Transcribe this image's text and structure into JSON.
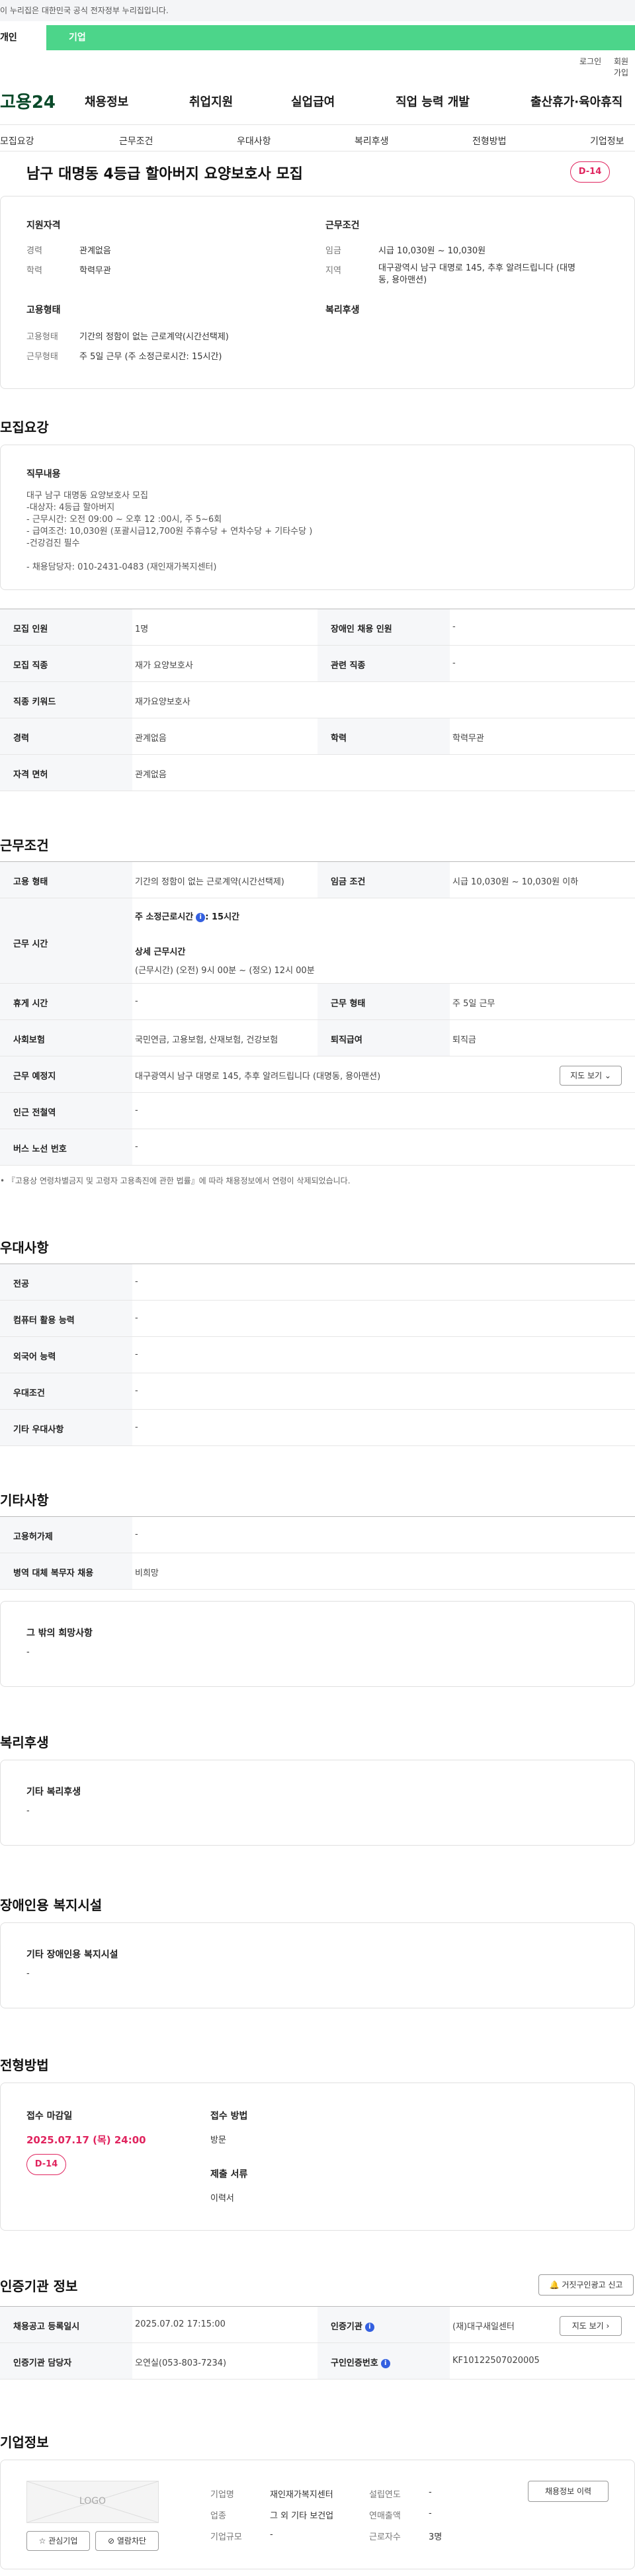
{
  "topbar": {
    "notice": "이 누리집은 대한민국 공식 전자정부 누리집입니다."
  },
  "tabs": {
    "personal": "개인",
    "corp": "기업"
  },
  "util": {
    "login": "로그인",
    "signup": "회원가입"
  },
  "logo": "고용24",
  "gnb": [
    "채용정보",
    "취업지원",
    "실업급여",
    "직업 능력 개발",
    "출산휴가·육아휴직"
  ],
  "subnav": [
    "모집요강",
    "근무조건",
    "우대사항",
    "복리후생",
    "전형방법",
    "기업정보"
  ],
  "job": {
    "title": "남구 대명동 4등급 할아버지 요양보호사 모집",
    "dday": "D-14"
  },
  "summary": {
    "qual_h": "지원자격",
    "cond_h": "근무조건",
    "career_k": "경력",
    "career_v": "관계없음",
    "edu_k": "학력",
    "edu_v": "학력무관",
    "wage_k": "임금",
    "wage_v": "시급 10,030원 ~ 10,030원",
    "region_k": "지역",
    "region_v1": "대구광역시 남구 대명로 145, 추후 알려드립니다 (대명",
    "region_v2": "동, 용아맨션)",
    "emp_h": "고용형태",
    "welfare_h": "복리후생",
    "emptype_k": "고용형태",
    "emptype_v": "기간의 정함이 없는 근로계약(시간선택제)",
    "worktype_k": "근무형태",
    "worktype_v": "주 5일 근무 (주 소정근로시간: 15시간)"
  },
  "recruit": {
    "section": "모집요강",
    "duty_h": "직무내용",
    "duty_lines": [
      "대구 남구 대명동  요양보호사 모집",
      "-대상자: 4등급 할아버지",
      "- 근무시간: 오전 09:00 ~ 오후 12 :00시, 주 5~6회",
      "- 급여조건: 10,030원 (포괄시급12,700원 주휴수당 + 연차수당 + 기타수당 )",
      "-건강검진 필수",
      "",
      "- 채용담당자: 010-2431-0483 (재인재가복지센터)"
    ],
    "rows": [
      {
        "k1": "모집 인원",
        "v1": "1명",
        "k2": "장애인 채용 인원",
        "v2": "-"
      },
      {
        "k1": "모집 직종",
        "v1": "재가 요양보호사",
        "k2": "관련 직종",
        "v2": "-"
      },
      {
        "k1": "직종 키워드",
        "v1": "재가요양보호사",
        "k2": "",
        "v2": ""
      },
      {
        "k1": "경력",
        "v1": "관계없음",
        "k2": "학력",
        "v2": "학력무관"
      },
      {
        "k1": "자격 면허",
        "v1": "관계없음",
        "k2": "",
        "v2": ""
      }
    ]
  },
  "conditions": {
    "section": "근무조건",
    "emp_k": "고용 형태",
    "emp_v": "기간의 정함이 없는 근로계약(시간선택제)",
    "wage_k": "임금 조건",
    "wage_v": "시급 10,030원 ~ 10,030원 이하",
    "hours_k": "근무 시간",
    "hours_main": "주 소정근로시간",
    "hours_val": ": 15시간",
    "detail_h": "상세 근무시간",
    "detail_v": "(근무시간) (오전) 9시 00분 ~ (정오) 12시 00분",
    "rest_k": "휴게 시간",
    "rest_v": "-",
    "worktype_k": "근무 형태",
    "worktype_v": "주 5일 근무",
    "ins_k": "사회보험",
    "ins_v": "국민연금, 고용보험, 산재보험, 건강보험",
    "ret_k": "퇴직급여",
    "ret_v": "퇴직금",
    "place_k": "근무 예정지",
    "place_v": "대구광역시 남구 대명로 145, 추후 알려드립니다 (대명동, 용아맨션)",
    "map_btn": "지도 보기",
    "subway_k": "인근 전철역",
    "subway_v": "-",
    "bus_k": "버스 노선 번호",
    "bus_v": "-",
    "footnote": "『고용상 연령차별금지 및 고령자 고용촉진에 관한 법률』에 따라 채용정보에서 연령이 삭제되었습니다."
  },
  "pref": {
    "section": "우대사항",
    "rows": [
      [
        "전공",
        "-"
      ],
      [
        "컴퓨터 활용 능력",
        "-"
      ],
      [
        "외국어 능력",
        "-"
      ],
      [
        "우대조건",
        "-"
      ],
      [
        "기타 우대사항",
        "-"
      ]
    ]
  },
  "etc": {
    "section": "기타사항",
    "rows": [
      [
        "고용허가제",
        "-"
      ],
      [
        "병역 대체 복무자 채용",
        "비희망"
      ]
    ],
    "hope_h": "그 밖의 희망사항",
    "hope_v": "-"
  },
  "welfare": {
    "section": "복리후생",
    "h": "기타 복리후생",
    "v": "-"
  },
  "disab": {
    "section": "장애인용 복지시설",
    "h": "기타 장애인용 복지시설",
    "v": "-"
  },
  "process": {
    "section": "전형방법",
    "deadline_h": "접수 마감일",
    "deadline_v": "2025.07.17 (목) 24:00",
    "dday": "D-14",
    "method_h": "접수 방법",
    "method_v": "방문",
    "docs_h": "제출 서류",
    "docs_v": "이력서"
  },
  "agency": {
    "section": "인증기관 정보",
    "report_btn": "거짓구인광고 신고",
    "reg_k": "채용공고 등록일시",
    "reg_v": "2025.07.02 17:15:00",
    "org_k": "인증기관",
    "org_v": "(재)대구새일센터",
    "map_btn": "지도 보기",
    "mgr_k": "인증기관 담당자",
    "mgr_v": "오연실(053-803-7234)",
    "num_k": "구인인증번호",
    "num_v": "KF10122507020005"
  },
  "company": {
    "section": "기업정보",
    "logo": "LOGO",
    "fav_btn": "관심기업",
    "block_btn": "열람차단",
    "name_k": "기업명",
    "name_v": "재인재가복지센터",
    "year_k": "설립연도",
    "year_v": "-",
    "ind_k": "업종",
    "ind_v": "그 외 기타 보건업",
    "sales_k": "연매출액",
    "sales_v": "-",
    "size_k": "기업규모",
    "size_v": "-",
    "emp_k": "근로자수",
    "emp_v": "3명",
    "history_btn": "채용정보 이력"
  }
}
